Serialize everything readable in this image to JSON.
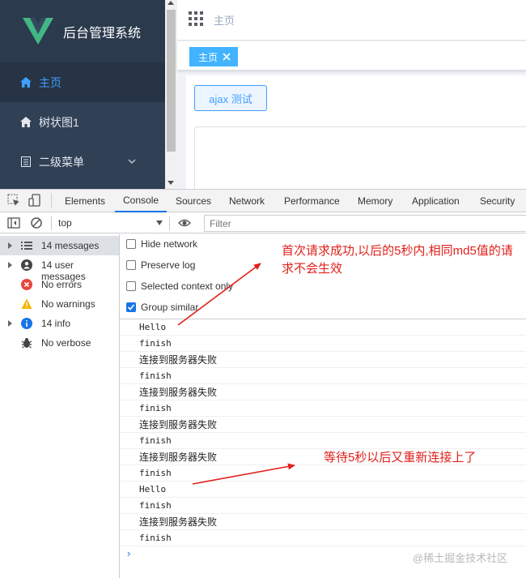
{
  "app": {
    "title": "后台管理系统",
    "menu": [
      {
        "label": "主页",
        "icon": "home-icon",
        "active": true
      },
      {
        "label": "树状图1",
        "icon": "home-icon"
      },
      {
        "label": "二级菜单",
        "icon": "document-icon"
      }
    ],
    "breadcrumb": "主页",
    "tag": "主页",
    "ajax_button": "ajax 测试",
    "colors": {
      "sidebar": "#304156",
      "accent": "#409eff",
      "tag": "#42b3ff"
    }
  },
  "devtools": {
    "tabs": [
      "Elements",
      "Console",
      "Sources",
      "Network",
      "Performance",
      "Memory",
      "Application",
      "Security"
    ],
    "active_tab": "Console",
    "context": "top",
    "filter_placeholder": "Filter",
    "sidebar": [
      {
        "label": "14 messages",
        "icon": "list-icon",
        "expandable": true
      },
      {
        "label": "14 user messages",
        "icon": "user-icon",
        "expandable": true
      },
      {
        "label": "No errors",
        "icon": "error-icon",
        "expandable": false
      },
      {
        "label": "No warnings",
        "icon": "warning-icon",
        "expandable": false
      },
      {
        "label": "14 info",
        "icon": "info-icon",
        "expandable": true
      },
      {
        "label": "No verbose",
        "icon": "bug-icon",
        "expandable": false
      }
    ],
    "settings": [
      {
        "label": "Hide network",
        "checked": false
      },
      {
        "label": "Preserve log",
        "checked": false
      },
      {
        "label": "Selected context only",
        "checked": false
      },
      {
        "label": "Group similar",
        "checked": true
      }
    ],
    "logs": [
      "Hello",
      "finish",
      "连接到服务器失败",
      "finish",
      "连接到服务器失败",
      "finish",
      "连接到服务器失败",
      "finish",
      "连接到服务器失败",
      "finish",
      "Hello",
      "finish",
      "连接到服务器失败",
      "finish"
    ]
  },
  "annotations": {
    "first": "首次请求成功,以后的5秒内,相同md5值的请求不会生效",
    "second": "等待5秒以后又重新连接上了",
    "color": "#e0201b"
  },
  "watermark": "@稀土掘金技术社区"
}
